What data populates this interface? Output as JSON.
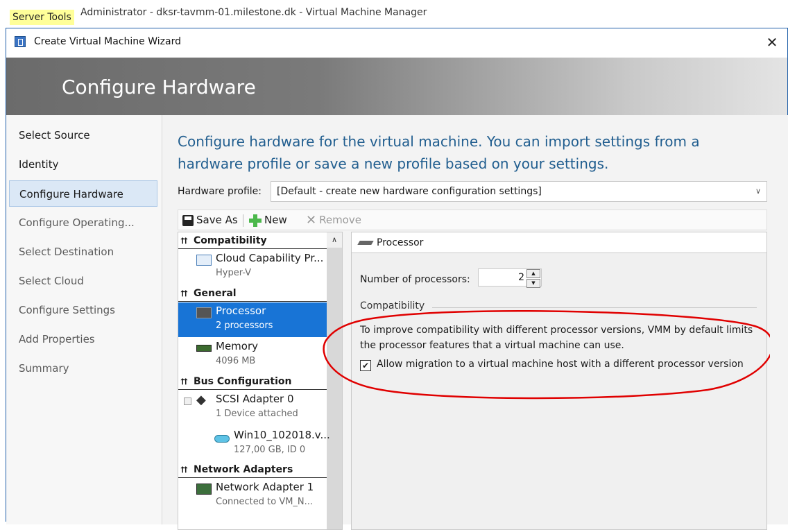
{
  "background": {
    "server_tools": "Server Tools",
    "window_title": "Administrator - dksr-tavmm-01.milestone.dk - Virtual Machine Manager"
  },
  "wizard": {
    "title": "Create Virtual Machine Wizard",
    "close_glyph": "✕",
    "banner_title": "Configure Hardware"
  },
  "nav": [
    {
      "label": "Select Source"
    },
    {
      "label": "Identity"
    },
    {
      "label": "Configure Hardware"
    },
    {
      "label": "Configure Operating..."
    },
    {
      "label": "Select Destination"
    },
    {
      "label": "Select Cloud"
    },
    {
      "label": "Configure Settings"
    },
    {
      "label": "Add Properties"
    },
    {
      "label": "Summary"
    }
  ],
  "main": {
    "heading": "Configure hardware for the virtual machine. You can import settings from a hardware profile or save a new profile based on your settings.",
    "hardware_profile_label": "Hardware profile:",
    "hardware_profile_value": "[Default - create new hardware configuration settings]",
    "toolbar": {
      "save_as": "Save As",
      "new": "New",
      "remove": "Remove"
    }
  },
  "tree": {
    "compatibility": "Compatibility",
    "cloud_title": "Cloud Capability Pr...",
    "cloud_sub": "Hyper-V",
    "general": "General",
    "processor_title": "Processor",
    "processor_sub": "2 processors",
    "memory_title": "Memory",
    "memory_sub": "4096 MB",
    "bus": "Bus Configuration",
    "scsi_title": "SCSI Adapter 0",
    "scsi_sub": "1 Device attached",
    "disk_title": "Win10_102018.v...",
    "disk_sub": "127,00 GB, ID 0",
    "network": "Network Adapters",
    "net_title": "Network Adapter 1",
    "net_sub": "Connected to VM_N..."
  },
  "detail": {
    "header": "Processor",
    "num_label": "Number of processors:",
    "num_value": "2",
    "group_label": "Compatibility",
    "comp_text": "To improve compatibility with different processor versions, VMM by default limits the processor features that a virtual machine can use.",
    "allow_migration_label": "Allow migration to a virtual machine host with a different processor version",
    "allow_migration_checked": true
  },
  "colors": {
    "accent": "#215e8f",
    "selected": "#1874d6",
    "annotation": "#e00000"
  }
}
